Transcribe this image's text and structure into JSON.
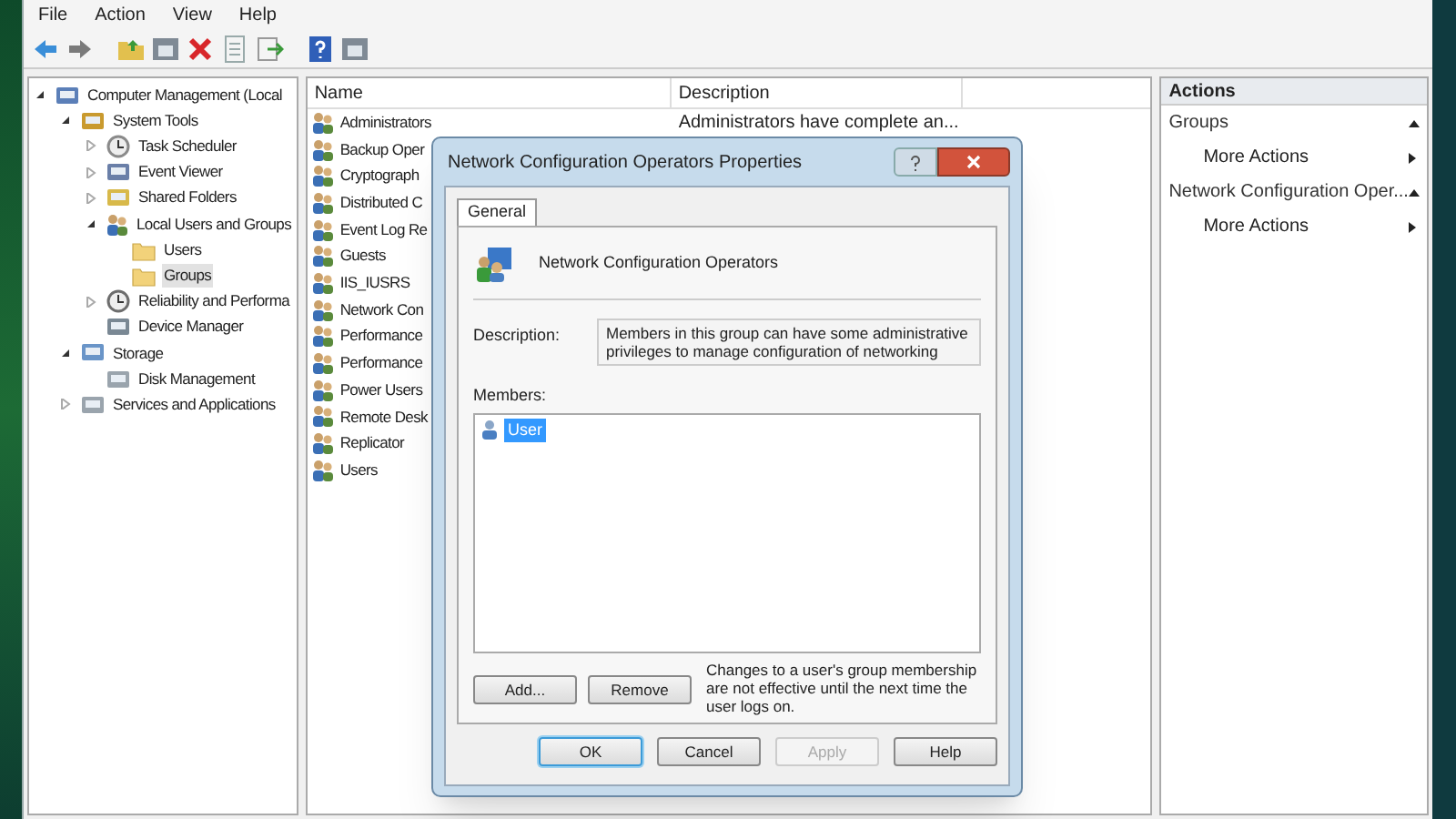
{
  "menu": [
    "File",
    "Action",
    "View",
    "Help"
  ],
  "tree": [
    {
      "label": "Computer Management (Local",
      "expanded": true,
      "selected": false,
      "children": [
        {
          "label": "System Tools",
          "expanded": true,
          "selected": false,
          "children": [
            {
              "label": "Task Scheduler",
              "expanded": false,
              "selected": false
            },
            {
              "label": "Event Viewer",
              "expanded": false,
              "selected": false
            },
            {
              "label": "Shared Folders",
              "expanded": false,
              "selected": false
            },
            {
              "label": "Local Users and Groups",
              "expanded": true,
              "selected": false,
              "children": [
                {
                  "label": "Users",
                  "selected": false
                },
                {
                  "label": "Groups",
                  "selected": true
                }
              ]
            },
            {
              "label": "Reliability and Performa",
              "expanded": false,
              "selected": false
            },
            {
              "label": "Device Manager",
              "selected": false
            }
          ]
        },
        {
          "label": "Storage",
          "expanded": true,
          "selected": false,
          "children": [
            {
              "label": "Disk Management",
              "selected": false
            }
          ]
        },
        {
          "label": "Services and Applications",
          "expanded": false,
          "selected": false
        }
      ]
    }
  ],
  "list": {
    "columns": [
      "Name",
      "Description"
    ],
    "rows": [
      {
        "name": "Administrators",
        "description": "Administrators have complete an..."
      },
      {
        "name": "Backup Oper"
      },
      {
        "name": "Cryptograph"
      },
      {
        "name": "Distributed C"
      },
      {
        "name": "Event Log Re"
      },
      {
        "name": "Guests"
      },
      {
        "name": "IIS_IUSRS"
      },
      {
        "name": "Network Con"
      },
      {
        "name": "Performance"
      },
      {
        "name": "Performance"
      },
      {
        "name": "Power Users"
      },
      {
        "name": "Remote Desk"
      },
      {
        "name": "Replicator"
      },
      {
        "name": "Users"
      }
    ]
  },
  "actions": {
    "title": "Actions",
    "sections": [
      {
        "title": "Groups",
        "items": [
          "More Actions"
        ]
      },
      {
        "title": "Network Configuration Oper...",
        "items": [
          "More Actions"
        ]
      }
    ]
  },
  "dialog": {
    "title": "Network Configuration Operators Properties",
    "tabs": [
      {
        "label": "General",
        "selected": true
      }
    ],
    "group_name": "Network Configuration Operators",
    "description_label": "Description:",
    "description": "Members in this group can have some administrative privileges to manage configuration of networking",
    "members_label": "Members:",
    "members": [
      {
        "name": "User",
        "selected": true
      }
    ],
    "member_buttons": [
      "Add...",
      "Remove"
    ],
    "note": "Changes to a user's group membership are not effective until the next time the user logs on.",
    "buttons": [
      {
        "label": "OK",
        "disabled": false,
        "default": true
      },
      {
        "label": "Cancel",
        "disabled": false,
        "default": false
      },
      {
        "label": "Apply",
        "disabled": true,
        "default": false
      },
      {
        "label": "Help",
        "disabled": false,
        "default": false
      }
    ]
  }
}
